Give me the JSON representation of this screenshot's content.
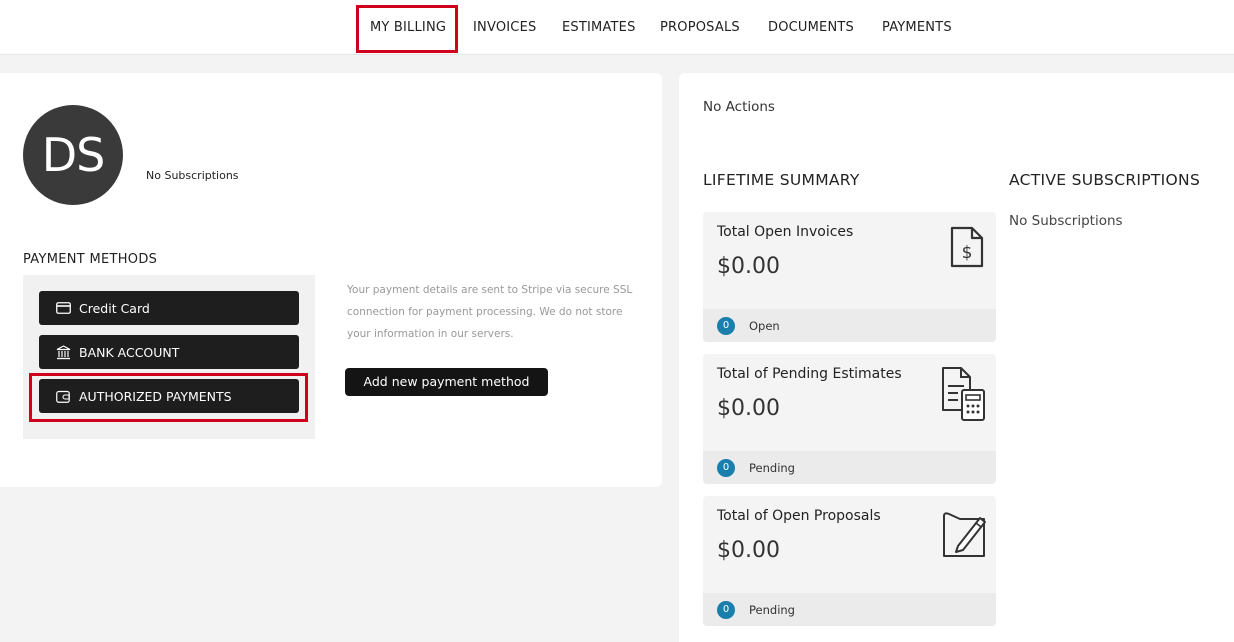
{
  "nav": {
    "items": [
      {
        "label": "MY BILLING"
      },
      {
        "label": "INVOICES"
      },
      {
        "label": "ESTIMATES"
      },
      {
        "label": "PROPOSALS"
      },
      {
        "label": "DOCUMENTS"
      },
      {
        "label": "PAYMENTS"
      }
    ]
  },
  "profile": {
    "initials": "DS",
    "subscriptions_text": "No Subscriptions"
  },
  "payment_methods": {
    "heading": "PAYMENT METHODS",
    "buttons": [
      {
        "label": "Credit Card",
        "icon": "credit-card-icon"
      },
      {
        "label": "BANK ACCOUNT",
        "icon": "bank-icon"
      },
      {
        "label": "AUTHORIZED PAYMENTS",
        "icon": "wallet-icon"
      }
    ],
    "note": "Your payment details are sent to Stripe via secure SSL connection for payment processing. We do not store your information in our servers.",
    "add_label": "Add new payment method"
  },
  "actions": {
    "text": "No Actions"
  },
  "lifetime": {
    "heading": "LIFETIME SUMMARY",
    "cards": [
      {
        "title": "Total Open Invoices",
        "amount": "$0.00",
        "count": "0",
        "status": "Open",
        "icon": "invoice-dollar-icon"
      },
      {
        "title": "Total of Pending Estimates",
        "amount": "$0.00",
        "count": "0",
        "status": "Pending",
        "icon": "estimate-calculator-icon"
      },
      {
        "title": "Total of Open Proposals",
        "amount": "$0.00",
        "count": "0",
        "status": "Pending",
        "icon": "proposal-signature-icon"
      }
    ]
  },
  "active_subscriptions": {
    "heading": "ACTIVE SUBSCRIPTIONS",
    "empty_text": "No Subscriptions"
  },
  "colors": {
    "highlight": "#d0021b",
    "badge": "#1b7fad",
    "button": "#1e1e1e"
  }
}
